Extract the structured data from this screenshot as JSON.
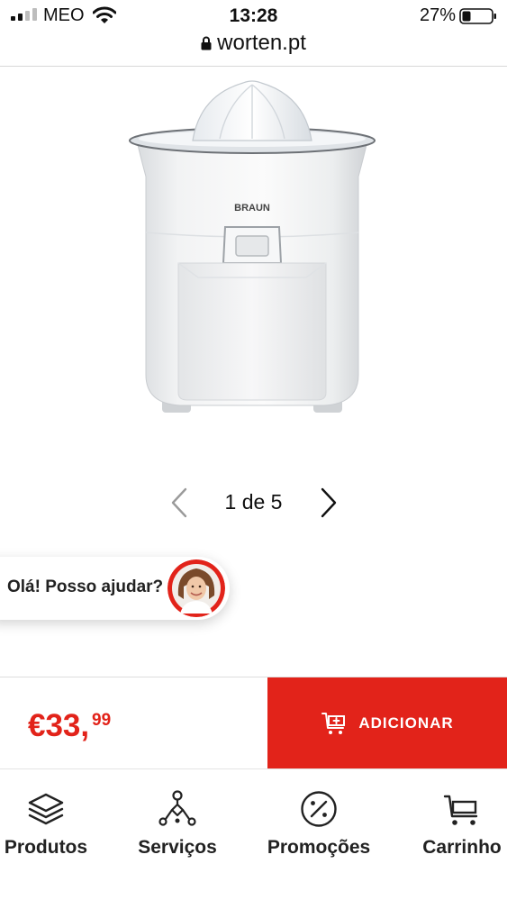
{
  "status_bar": {
    "carrier": "MEO",
    "time": "13:28",
    "battery": "27%"
  },
  "url_bar": {
    "domain": "worten.pt"
  },
  "product": {
    "brand_on_image": "BRAUN",
    "image_icon": "citrus-juicer-image"
  },
  "carousel": {
    "current": 1,
    "total": 5,
    "label": "1 de 5"
  },
  "chat": {
    "greeting": "Olá! Posso ajudar?",
    "avatar_icon": "assistant-avatar"
  },
  "purchase": {
    "price_main": "€33,",
    "price_cents": "99",
    "add_label": "ADICIONAR",
    "add_icon": "cart-plus-icon"
  },
  "bottom_nav": {
    "items": [
      {
        "label": "Produtos",
        "icon": "layers-icon"
      },
      {
        "label": "Serviços",
        "icon": "network-icon"
      },
      {
        "label": "Promoções",
        "icon": "percent-icon"
      },
      {
        "label": "Carrinho",
        "icon": "cart-icon"
      }
    ]
  },
  "colors": {
    "brand_red": "#e2231a",
    "text": "#111111",
    "divider": "#d7d7d7"
  }
}
